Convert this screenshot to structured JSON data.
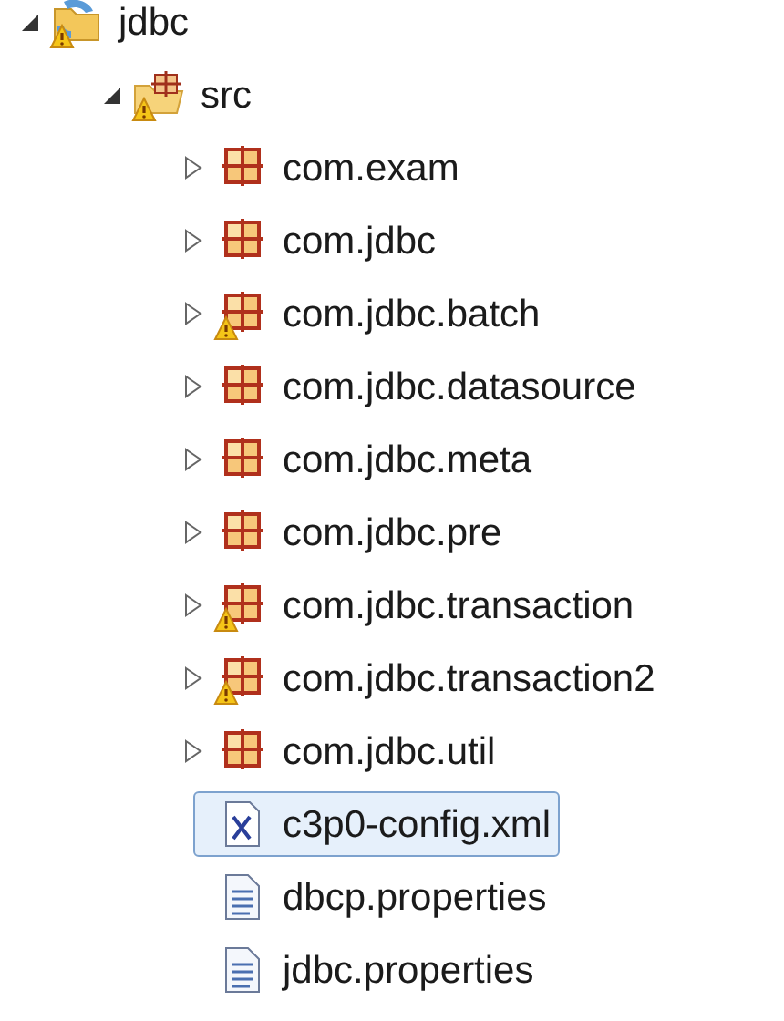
{
  "tree": [
    {
      "kind": "project",
      "label": "jdbc",
      "warning": true,
      "expanded": true,
      "selected": false,
      "children": [
        {
          "kind": "source-folder",
          "label": "src",
          "warning": true,
          "expanded": true,
          "selected": false,
          "children": [
            {
              "kind": "package",
              "label": "com.exam",
              "warning": false,
              "expanded": false,
              "selected": false
            },
            {
              "kind": "package",
              "label": "com.jdbc",
              "warning": false,
              "expanded": false,
              "selected": false
            },
            {
              "kind": "package",
              "label": "com.jdbc.batch",
              "warning": true,
              "expanded": false,
              "selected": false
            },
            {
              "kind": "package",
              "label": "com.jdbc.datasource",
              "warning": false,
              "expanded": false,
              "selected": false
            },
            {
              "kind": "package",
              "label": "com.jdbc.meta",
              "warning": false,
              "expanded": false,
              "selected": false
            },
            {
              "kind": "package",
              "label": "com.jdbc.pre",
              "warning": false,
              "expanded": false,
              "selected": false
            },
            {
              "kind": "package",
              "label": "com.jdbc.transaction",
              "warning": true,
              "expanded": false,
              "selected": false
            },
            {
              "kind": "package",
              "label": "com.jdbc.transaction2",
              "warning": true,
              "expanded": false,
              "selected": false
            },
            {
              "kind": "package",
              "label": "com.jdbc.util",
              "warning": false,
              "expanded": false,
              "selected": false
            },
            {
              "kind": "xml-file",
              "label": "c3p0-config.xml",
              "warning": false,
              "selected": true
            },
            {
              "kind": "text-file",
              "label": "dbcp.properties",
              "warning": false,
              "selected": false
            },
            {
              "kind": "text-file",
              "label": "jdbc.properties",
              "warning": false,
              "selected": false
            }
          ]
        }
      ]
    }
  ]
}
